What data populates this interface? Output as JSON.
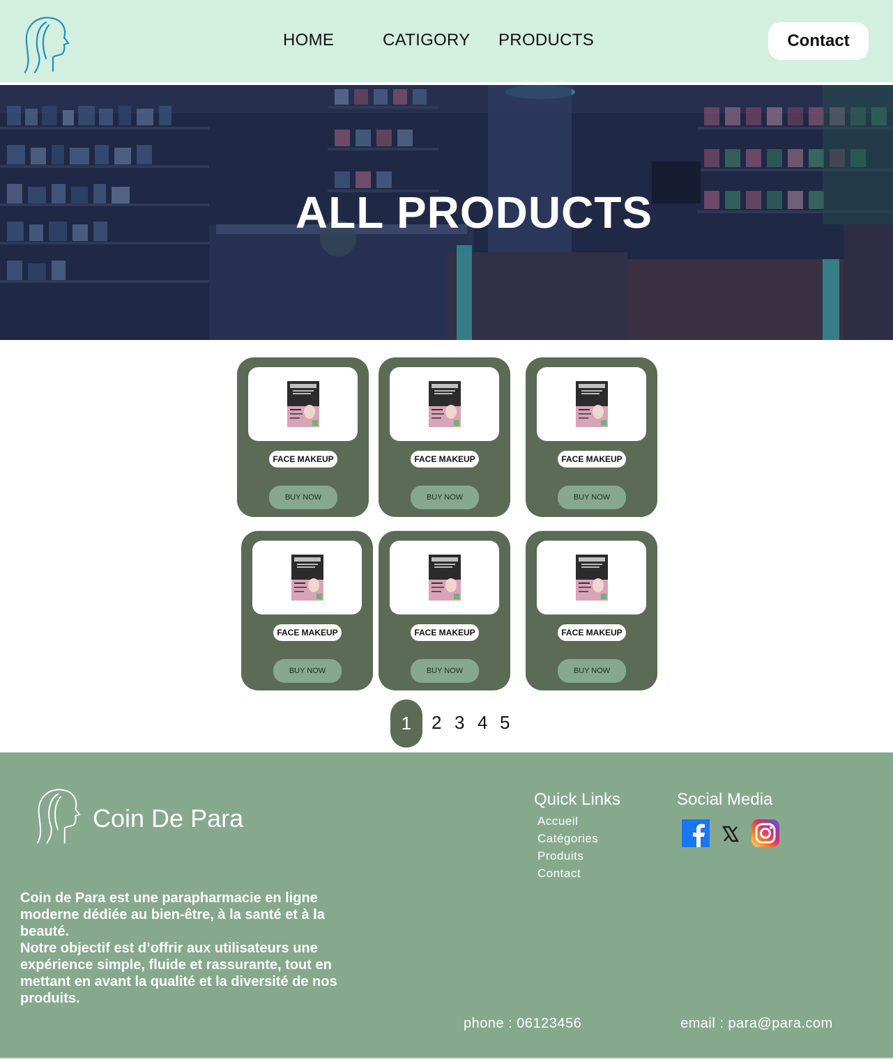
{
  "header": {
    "nav": [
      "HOME",
      "CATIGORY",
      "PRODUCTS"
    ],
    "contact_label": "Contact"
  },
  "hero": {
    "title": "ALL PRODUCTS"
  },
  "products": [
    {
      "name": "FACE MAKEUP",
      "buy_label": "BUY NOW"
    },
    {
      "name": "FACE MAKEUP",
      "buy_label": "BUY NOW"
    },
    {
      "name": "FACE MAKEUP",
      "buy_label": "BUY NOW"
    },
    {
      "name": "FACE MAKEUP",
      "buy_label": "BUY NOW"
    },
    {
      "name": "FACE MAKEUP",
      "buy_label": "BUY NOW"
    },
    {
      "name": "FACE MAKEUP",
      "buy_label": "BUY NOW"
    }
  ],
  "pagination": {
    "pages": [
      "1",
      "2",
      "3",
      "4",
      "5"
    ],
    "current": "1"
  },
  "footer": {
    "brand": "Coin De Para",
    "description": "Coin de Para est une parapharmacie en ligne moderne dédiée au bien-être, à la santé et à la beauté.\n Notre objectif est d’offrir aux utilisateurs une expérience simple, fluide et rassurante, tout en mettant en avant la qualité et la diversité de nos produits.",
    "quick_links_title": "Quick Links",
    "quick_links": [
      "Accueil",
      "Catégories",
      "Produits",
      "Contact"
    ],
    "social_title": "Social Media",
    "social_icons": [
      "facebook-icon",
      "x-icon",
      "instagram-icon"
    ],
    "phone": "phone : 06123456",
    "email": "email : para@para.com"
  },
  "colors": {
    "header_bg": "#d3efe0",
    "card_bg": "#5b6b55",
    "accent": "#86a98e",
    "footer_bg": "#86a98e"
  }
}
